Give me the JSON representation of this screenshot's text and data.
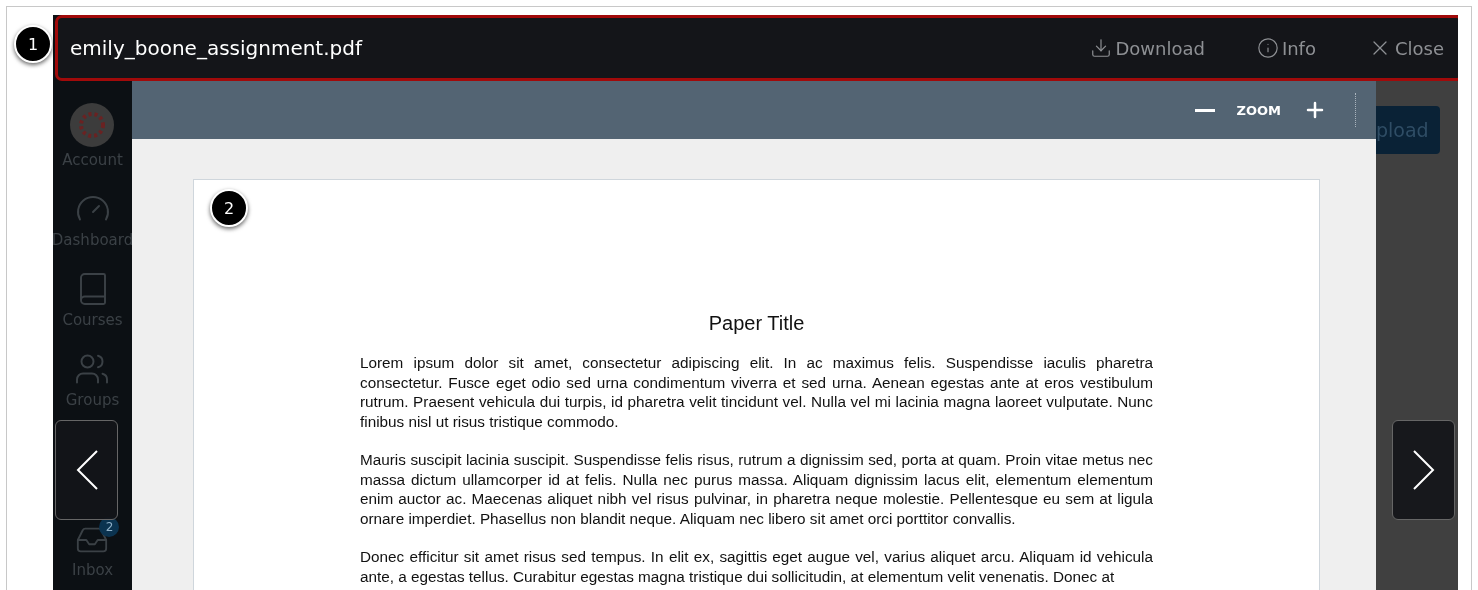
{
  "viewer": {
    "filename": "emily_boone_assignment.pdf",
    "actions": [
      {
        "kind": "download",
        "label": "Download"
      },
      {
        "kind": "info",
        "label": "Info"
      },
      {
        "kind": "close",
        "label": "Close"
      }
    ],
    "zoom": {
      "label": "ZOOM"
    }
  },
  "background": {
    "nav": [
      {
        "kind": "account",
        "label": "Account"
      },
      {
        "kind": "dashboard",
        "label": "Dashboard"
      },
      {
        "kind": "courses",
        "label": "Courses"
      },
      {
        "kind": "groups",
        "label": "Groups"
      },
      {
        "kind": "inbox",
        "label": "Inbox",
        "badge": "2"
      }
    ],
    "upload_button": "pload"
  },
  "callouts": [
    "1",
    "2"
  ],
  "document": {
    "title": "Paper Title",
    "paragraphs": [
      "Lorem ipsum dolor sit amet, consectetur adipiscing elit. In ac maximus felis. Suspendisse iaculis pharetra consectetur. Fusce eget odio sed urna condimentum viverra et sed urna. Aenean egestas ante at eros vestibulum rutrum. Praesent vehicula dui turpis, id pharetra velit tincidunt vel. Nulla vel mi lacinia magna laoreet vulputate. Nunc finibus nisl ut risus tristique commodo.",
      "Mauris suscipit lacinia suscipit. Suspendisse felis risus, rutrum a dignissim sed, porta at quam. Proin vitae metus nec massa dictum ullamcorper id at felis. Nulla nec purus massa. Aliquam dignissim lacus elit, elementum elementum enim auctor ac. Maecenas aliquet nibh vel risus pulvinar, in pharetra neque molestie. Pellentesque eu sem at ligula ornare imperdiet. Phasellus non blandit neque. Aliquam nec libero sit amet orci porttitor convallis.",
      "Donec efficitur sit amet risus sed tempus. In elit ex, sagittis eget augue vel, varius aliquet arcu. Aliquam id vehicula ante, a egestas tellus. Curabitur egestas magna tristique dui sollicitudin, at elementum velit venenatis. Donec at"
    ]
  }
}
